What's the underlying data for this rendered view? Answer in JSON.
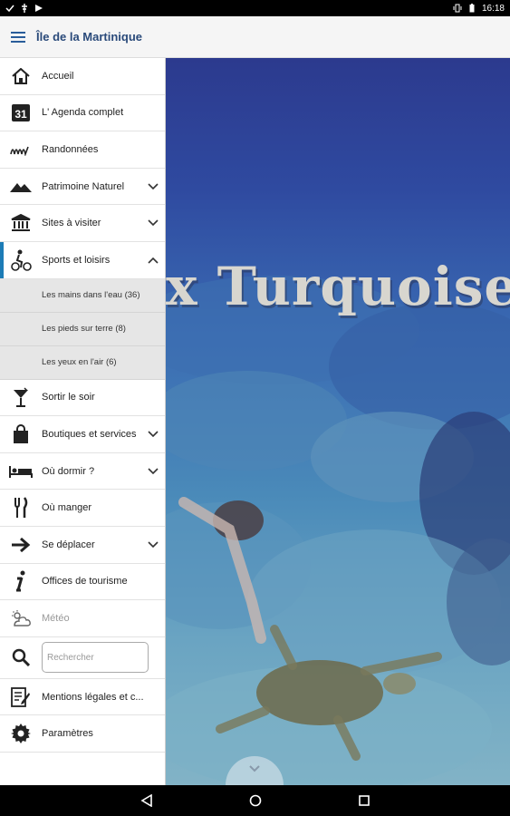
{
  "status": {
    "time": "16:18"
  },
  "app": {
    "title": "Île de la Martinique"
  },
  "hero": {
    "text": "x Turquoise"
  },
  "menu": {
    "accueil": "Accueil",
    "agenda": "L' Agenda complet",
    "agenda_icon_text": "31",
    "randonnees": "Randonnées",
    "patrimoine": "Patrimoine Naturel",
    "sites": "Sites à visiter",
    "sports": "Sports et loisirs",
    "sports_sub": [
      "Les mains dans l'eau (36)",
      "Les pieds sur terre (8)",
      "Les yeux en l'air (6)"
    ],
    "sortir": "Sortir le soir",
    "boutiques": "Boutiques et services",
    "dormir": "Où dormir ?",
    "manger": "Où manger",
    "deplacer": "Se déplacer",
    "offices": "Offices de tourisme",
    "meteo": "Météo",
    "mentions": "Mentions légales et c...",
    "parametres": "Paramètres"
  },
  "search": {
    "placeholder": "Rechercher"
  },
  "colors": {
    "accent": "#1d7cb6",
    "title": "#2a4a7a",
    "ocean": "#2f4aa0"
  }
}
